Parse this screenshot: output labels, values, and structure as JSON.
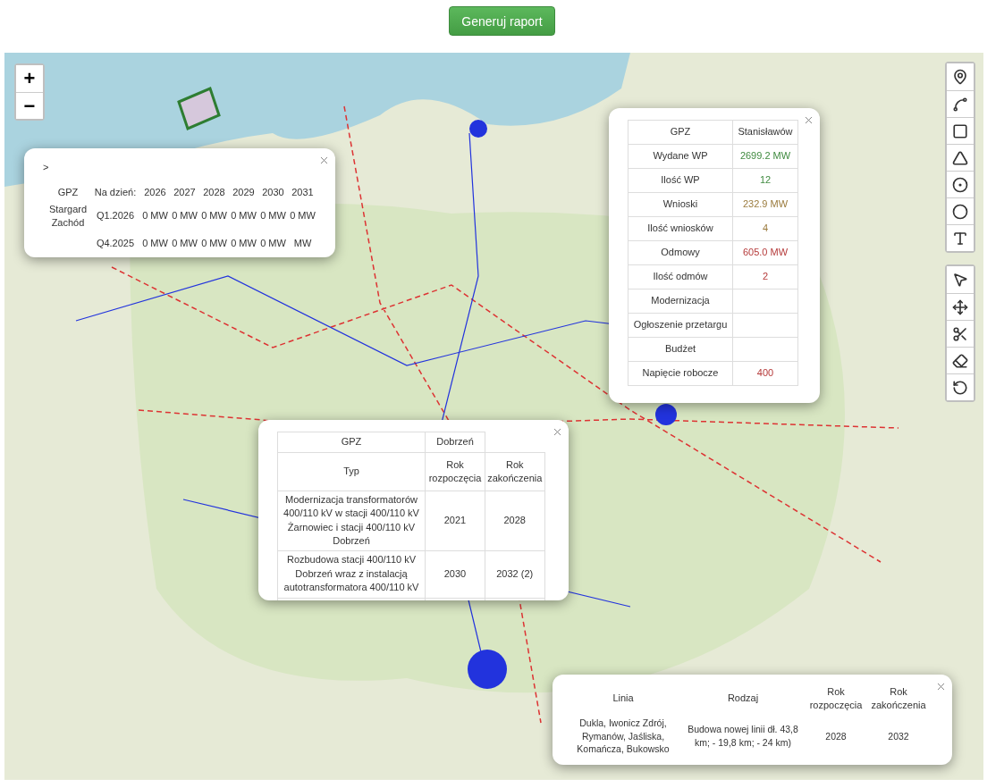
{
  "report_button": "Generuj raport",
  "zoom": {
    "zoom_in": "+",
    "zoom_out": "−"
  },
  "draw_tools": [
    {
      "kind": "marker"
    },
    {
      "kind": "line"
    },
    {
      "kind": "rectangle"
    },
    {
      "kind": "polygon"
    },
    {
      "kind": "circle"
    },
    {
      "kind": "circle-marker"
    },
    {
      "kind": "text"
    }
  ],
  "edit_tools": [
    {
      "kind": "select"
    },
    {
      "kind": "move"
    },
    {
      "kind": "cut"
    },
    {
      "kind": "erase"
    },
    {
      "kind": "rotate"
    }
  ],
  "forecast_popup": {
    "prefix": ">",
    "columns": [
      "GPZ",
      "Na dzień:",
      "2026",
      "2027",
      "2028",
      "2029",
      "2030",
      "2031"
    ],
    "groups": [
      {
        "gpz": "Stargard Zachód",
        "rows": [
          {
            "date": "Q1.2026",
            "values": [
              "0 MW",
              "0 MW",
              "0 MW",
              "0 MW",
              "0 MW",
              "0 MW"
            ]
          },
          {
            "date": "Q4.2025",
            "values": [
              "0 MW",
              "0 MW",
              "0 MW",
              "0 MW",
              "0 MW",
              "MW"
            ]
          }
        ]
      }
    ]
  },
  "summary_popup": {
    "header": [
      "GPZ",
      "Stanisławów"
    ],
    "rows": [
      {
        "label": "Wydane WP",
        "value": "2699.2 MW",
        "kind": "issued"
      },
      {
        "label": "Ilość WP",
        "value": "12",
        "kind": "issued"
      },
      {
        "label": "Wnioski",
        "value": "232.9 MW",
        "kind": "requested"
      },
      {
        "label": "Ilość wniosków",
        "value": "4",
        "kind": "requested"
      },
      {
        "label": "Odmowy",
        "value": "605.0 MW",
        "kind": "refused"
      },
      {
        "label": "Ilość odmów",
        "value": "2",
        "kind": "refused"
      },
      {
        "label": "Modernizacja"
      },
      {
        "label": "Ogłoszenie przetargu"
      },
      {
        "label": "Budżet"
      },
      {
        "label": "Napięcie robocze",
        "value": "400",
        "kind": "voltage"
      }
    ]
  },
  "investment_popup": {
    "header": [
      "GPZ",
      "Dobrzeń"
    ],
    "columns": [
      "Typ",
      "Rok rozpoczęcia",
      "Rok zakończenia"
    ],
    "rows": [
      {
        "type": "Modernizacja transformatorów 400/110 kV w stacji 400/110 kV Żarnowiec i stacji 400/110 kV Dobrzeń",
        "start": "2021",
        "end": "2028"
      },
      {
        "type": "Rozbudowa stacji 400/110 kV Dobrzeń wraz z instalacją autotransformatora 400/110 kV",
        "start": "2030",
        "end": "2032 (2)"
      }
    ]
  },
  "line_popup": {
    "columns": [
      "Linia",
      "Rodzaj",
      "Rok rozpoczęcia",
      "Rok zakończenia"
    ],
    "rows": [
      {
        "cells": [
          "Dukla, Iwonicz Zdrój, Rymanów, Jaśliska, Komańcza, Bukowsko",
          "Budowa nowej linii dł. 43,8 km; - 19,8 km; - 24 km)",
          "2028",
          "2032"
        ]
      }
    ]
  }
}
